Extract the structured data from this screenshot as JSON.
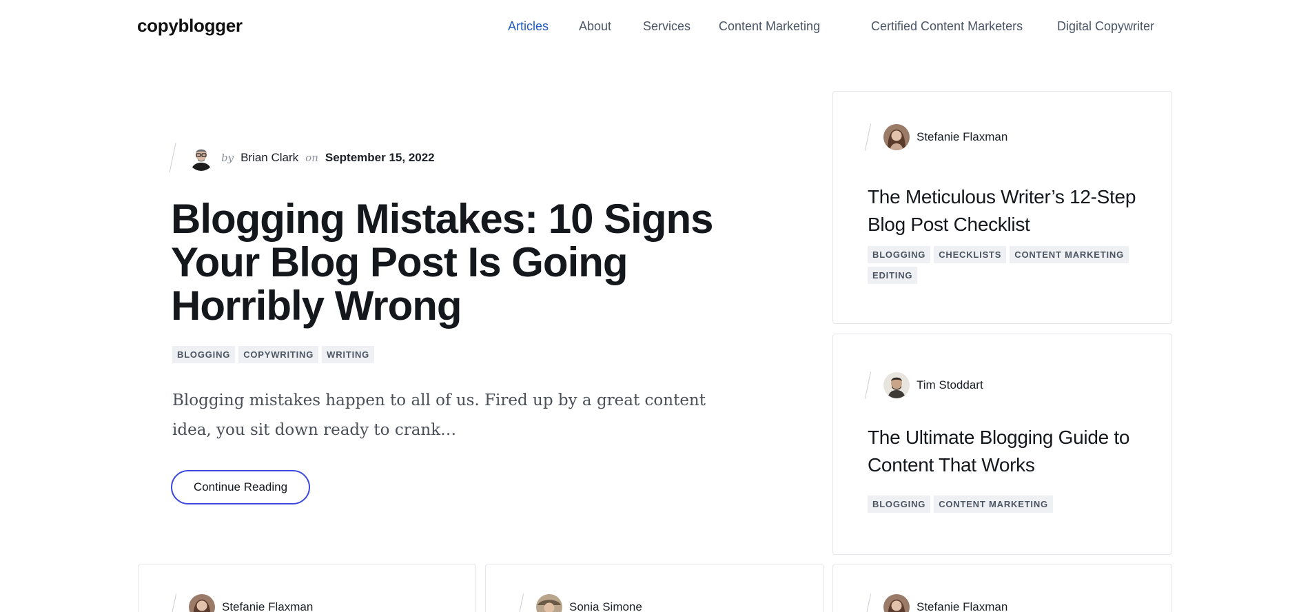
{
  "header": {
    "logo": "copyblogger",
    "nav": [
      {
        "label": "Articles",
        "active": true
      },
      {
        "label": "About",
        "active": false
      },
      {
        "label": "Services",
        "active": false
      },
      {
        "label": "Content Marketing",
        "active": false
      },
      {
        "label": "Certified Content Marketers",
        "active": false
      },
      {
        "label": "Digital Copywriter",
        "active": false
      }
    ]
  },
  "featured": {
    "by": "by",
    "author": "Brian Clark",
    "on": "on",
    "date": "September 15, 2022",
    "title": "Blogging Mistakes: 10 Signs Your Blog Post Is Going Horribly Wrong",
    "tags": [
      "BLOGGING",
      "COPYWRITING",
      "WRITING"
    ],
    "excerpt": "Blogging mistakes happen to all of us. Fired up by a great content idea, you sit down ready to crank…",
    "cta": "Continue Reading"
  },
  "sidebar_cards": [
    {
      "author": "Stefanie Flaxman",
      "title": "The Meticulous Writer’s 12-Step Blog Post Checklist",
      "tags": [
        "BLOGGING",
        "CHECKLISTS",
        "CONTENT MARKETING",
        "EDITING"
      ]
    },
    {
      "author": "Tim Stoddart",
      "title": "The Ultimate Blogging Guide to Content That Works",
      "tags": [
        "BLOGGING",
        "CONTENT MARKETING"
      ]
    }
  ],
  "bottom_cards": [
    {
      "author": "Stefanie Flaxman"
    },
    {
      "author": "Sonia Simone"
    },
    {
      "author": "Stefanie Flaxman"
    }
  ],
  "colors": {
    "accent_link": "#1f5bbf",
    "button_border": "#3b49df",
    "tag_bg": "#eef0f3"
  }
}
